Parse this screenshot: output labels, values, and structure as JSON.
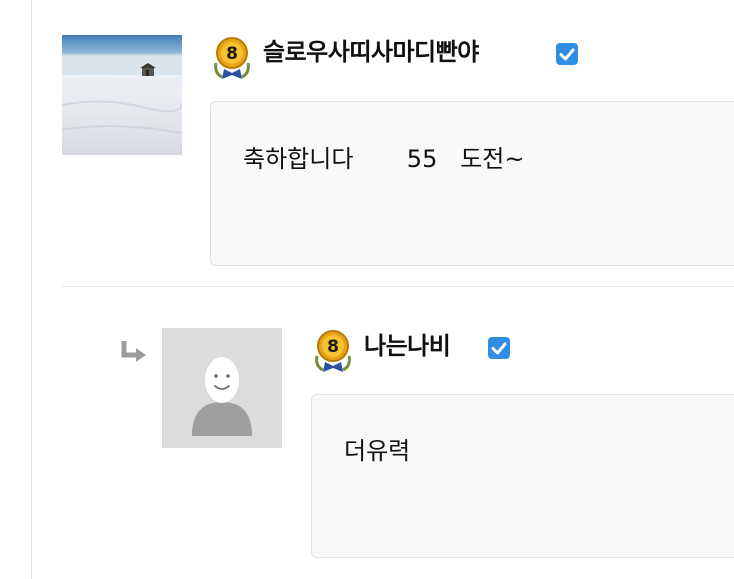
{
  "comments": [
    {
      "author": "슬로우사띠사마디빤야",
      "level": "8",
      "text": "축하합니다       55   도전~",
      "avatar": "snowfield-photo-avatar",
      "verified_icon": "verified-check-icon"
    },
    {
      "author": "나는나비",
      "level": "8",
      "text": "더유력",
      "avatar": "default-user-avatar",
      "verified_icon": "verified-check-icon",
      "is_reply": true,
      "reply_icon": "reply-arrow-icon"
    }
  ],
  "colors": {
    "verified": "#2f8de4",
    "bubble_bg": "#f8f9fa",
    "bubble_border": "#dedfe2",
    "badge_gold": "#e8a317",
    "badge_ribbon": "#2c4fa6"
  }
}
